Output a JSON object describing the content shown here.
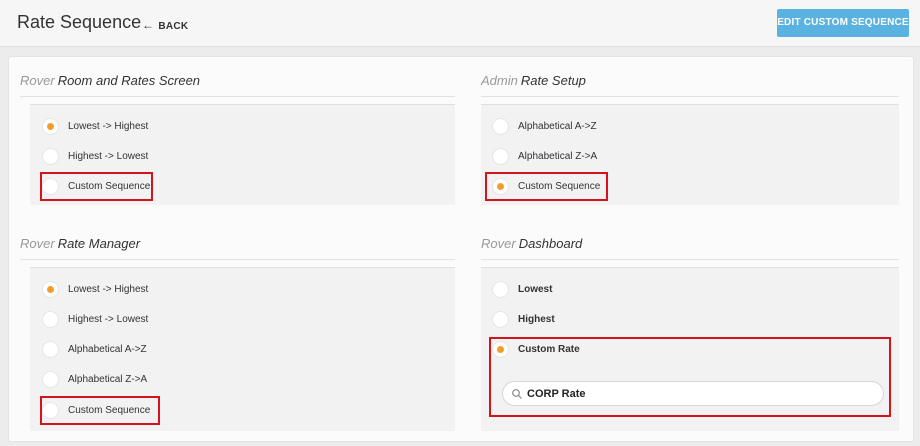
{
  "header": {
    "title": "Rate Sequence",
    "back_label": "BACK",
    "edit_button_label": "EDIT CUSTOM SEQUENCE"
  },
  "sections": {
    "rooms": {
      "prefix": "Rover",
      "title": "Room and Rates Screen",
      "options": [
        {
          "label": "Lowest -> Highest",
          "selected": true
        },
        {
          "label": "Highest -> Lowest",
          "selected": false
        },
        {
          "label": "Custom Sequence",
          "selected": false
        }
      ]
    },
    "admin": {
      "prefix": "Admin",
      "title": "Rate Setup",
      "options": [
        {
          "label": "Alphabetical A->Z",
          "selected": false
        },
        {
          "label": "Alphabetical Z->A",
          "selected": false
        },
        {
          "label": "Custom Sequence",
          "selected": true
        }
      ]
    },
    "manager": {
      "prefix": "Rover",
      "title": "Rate Manager",
      "options": [
        {
          "label": "Lowest -> Highest",
          "selected": true
        },
        {
          "label": "Highest -> Lowest",
          "selected": false
        },
        {
          "label": "Alphabetical A->Z",
          "selected": false
        },
        {
          "label": "Alphabetical Z->A",
          "selected": false
        },
        {
          "label": "Custom Sequence",
          "selected": false
        }
      ]
    },
    "dashboard": {
      "prefix": "Rover",
      "title": "Dashboard",
      "options": [
        {
          "label": "Lowest",
          "selected": false
        },
        {
          "label": "Highest",
          "selected": false
        },
        {
          "label": "Custom Rate",
          "selected": true
        }
      ],
      "search_value": "CORP Rate"
    }
  },
  "colors": {
    "accent_button": "#5ab2e0",
    "radio_selected": "#f39c2a",
    "highlight_box": "#d4141b"
  },
  "icons": {
    "back": "left-arrow-icon",
    "search": "search-icon"
  }
}
